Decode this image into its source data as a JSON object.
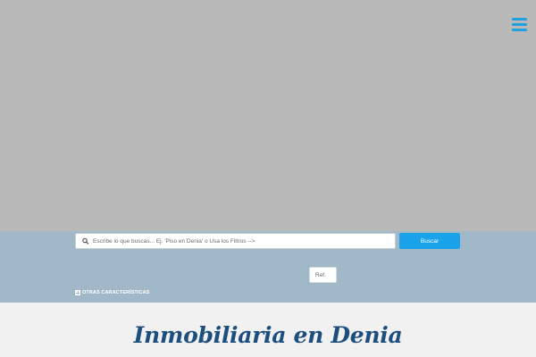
{
  "header": {
    "menu_icon": "hamburger-menu-icon",
    "accent_color": "#1ea1dc"
  },
  "search": {
    "placeholder": "Escribe lo que buscas... Ej. 'Piso en Denia' o Usa los Filtros -->",
    "icon": "search-icon",
    "button_label": "Buscar",
    "button_color": "#1aa3e8",
    "ref_placeholder": "Ref."
  },
  "filters": {
    "toggle_icon": "plus-square-icon",
    "toggle_label": "OTRAS CARACTERÍSTICAS",
    "band_color": "#a1b8c9"
  },
  "main": {
    "title": "Inmobiliaria en Denia",
    "title_color": "#1d4f7e"
  }
}
